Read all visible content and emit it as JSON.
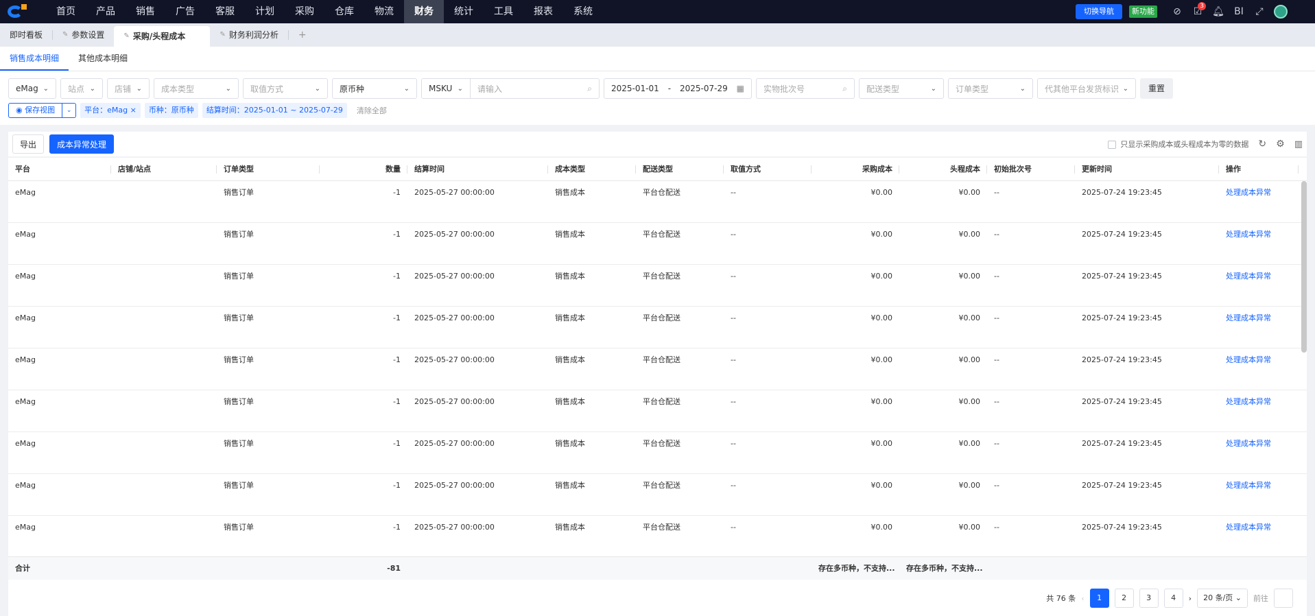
{
  "nav": {
    "menu": [
      "首页",
      "产品",
      "销售",
      "广告",
      "客服",
      "计划",
      "采购",
      "仓库",
      "物流",
      "财务",
      "统计",
      "工具",
      "报表",
      "系统"
    ],
    "active": "财务",
    "switch_label": "切换导航",
    "new_label": "新功能",
    "badge_count": "3",
    "bi_label": "BI"
  },
  "page_tabs": [
    {
      "label": "即时看板"
    },
    {
      "label": "参数设置"
    },
    {
      "label": "采购/头程成本"
    },
    {
      "label": "财务利润分析"
    }
  ],
  "sub_tabs": [
    "销售成本明细",
    "其他成本明细"
  ],
  "filters": {
    "platform": "eMag",
    "site_ph": "站点",
    "shop_ph": "店铺",
    "cost_type_ph": "成本类型",
    "value_method_ph": "取值方式",
    "currency": "原币种",
    "msku_label": "MSKU",
    "search_ph": "请输入",
    "date_start": "2025-01-01",
    "date_sep": "-",
    "date_end": "2025-07-29",
    "batch_ph": "实物批次号",
    "delivery_ph": "配送类型",
    "order_type_ph": "订单类型",
    "other_ph": "代其他平台发货标识",
    "reset_label": "重置"
  },
  "chips": {
    "save_view": "保存视图",
    "platform": "平台：eMag",
    "currency": "币种：原币种",
    "date": "结算时间：2025-01-01 ~ 2025-07-29",
    "clear": "清除全部"
  },
  "toolbar": {
    "export": "导出",
    "abnormal": "成本异常处理",
    "zero_only": "只显示采购成本或头程成本为零的数据"
  },
  "table": {
    "headers": [
      "平台",
      "店铺/站点",
      "订单类型",
      "数量",
      "结算时间",
      "成本类型",
      "配送类型",
      "取值方式",
      "采购成本",
      "头程成本",
      "初始批次号",
      "更新时间",
      "操作"
    ],
    "rows": [
      [
        "eMag",
        "",
        "销售订单",
        "-1",
        "2025-05-27 00:00:00",
        "销售成本",
        "平台仓配送",
        "--",
        "¥0.00",
        "¥0.00",
        "--",
        "2025-07-24 19:23:45",
        "处理成本异常"
      ],
      [
        "eMag",
        "",
        "销售订单",
        "-1",
        "2025-05-27 00:00:00",
        "销售成本",
        "平台仓配送",
        "--",
        "¥0.00",
        "¥0.00",
        "--",
        "2025-07-24 19:23:45",
        "处理成本异常"
      ],
      [
        "eMag",
        "",
        "销售订单",
        "-1",
        "2025-05-27 00:00:00",
        "销售成本",
        "平台仓配送",
        "--",
        "¥0.00",
        "¥0.00",
        "--",
        "2025-07-24 19:23:45",
        "处理成本异常"
      ],
      [
        "eMag",
        "",
        "销售订单",
        "-1",
        "2025-05-27 00:00:00",
        "销售成本",
        "平台仓配送",
        "--",
        "¥0.00",
        "¥0.00",
        "--",
        "2025-07-24 19:23:45",
        "处理成本异常"
      ],
      [
        "eMag",
        "",
        "销售订单",
        "-1",
        "2025-05-27 00:00:00",
        "销售成本",
        "平台仓配送",
        "--",
        "¥0.00",
        "¥0.00",
        "--",
        "2025-07-24 19:23:45",
        "处理成本异常"
      ],
      [
        "eMag",
        "",
        "销售订单",
        "-1",
        "2025-05-27 00:00:00",
        "销售成本",
        "平台仓配送",
        "--",
        "¥0.00",
        "¥0.00",
        "--",
        "2025-07-24 19:23:45",
        "处理成本异常"
      ],
      [
        "eMag",
        "",
        "销售订单",
        "-1",
        "2025-05-27 00:00:00",
        "销售成本",
        "平台仓配送",
        "--",
        "¥0.00",
        "¥0.00",
        "--",
        "2025-07-24 19:23:45",
        "处理成本异常"
      ],
      [
        "eMag",
        "",
        "销售订单",
        "-1",
        "2025-05-27 00:00:00",
        "销售成本",
        "平台仓配送",
        "--",
        "¥0.00",
        "¥0.00",
        "--",
        "2025-07-24 19:23:45",
        "处理成本异常"
      ],
      [
        "eMag",
        "",
        "销售订单",
        "-1",
        "2025-05-27 00:00:00",
        "销售成本",
        "平台仓配送",
        "--",
        "¥0.00",
        "¥0.00",
        "--",
        "2025-07-24 19:23:45",
        "处理成本异常"
      ]
    ],
    "footer": {
      "label": "合计",
      "qty": "-81",
      "purchase": "存在多币种，不支持...",
      "headway": "存在多币种，不支持..."
    }
  },
  "pager": {
    "total": "共 76 条",
    "pages": [
      "1",
      "2",
      "3",
      "4"
    ],
    "size": "20 条/页",
    "goto": "前往"
  }
}
